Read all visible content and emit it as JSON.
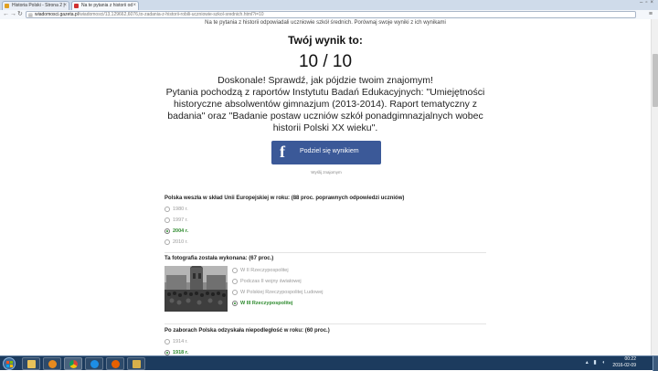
{
  "browser": {
    "tabs": [
      {
        "label": "Historia Polski - Strona 2 |",
        "icon_color": "#e0a020"
      },
      {
        "label": "Na te pytania z historii od",
        "icon_color": "#d03030"
      }
    ],
    "url_domain": "wiadomosci.gazeta.pl",
    "url_path": "/wiadomosci/13,129662,6076,to-zadania-z-historii-robili-uczniowie-szkol-srednich.html?i=10",
    "icons": [
      "back-icon",
      "forward-icon",
      "reload-icon",
      "menu-icon"
    ]
  },
  "page": {
    "top_line": "Na te pytania z historii odpowiadali uczniowie szkół średnich. Porównaj swoje wyniki z ich wynikami",
    "result_title": "Twój wynik to:",
    "score": "10 / 10",
    "description_1": "Doskonale! Sprawdź, jak pójdzie twoim znajomym!",
    "description_2": "Pytania pochodzą z raportów Instytutu Badań Edukacyjnych: \"Umiejętności historyczne absolwentów gimnazjum (2013-2014). Raport tematyczny z badania\" oraz \"Badanie postaw uczniów szkół ponadgimnazjalnych wobec historii Polski XX wieku\".",
    "fb_button_label": "Podziel się wynikiem",
    "fb_logo": "f",
    "fb_sub": "Wyślij znajomym",
    "accent_color": "#3b5998",
    "correct_color": "#2d8a2d"
  },
  "questions": [
    {
      "title": "Polska weszła w skład Unii Europejskiej w roku: (88 proc. poprawnych odpowiedzi uczniów)",
      "options": [
        "1980 r.",
        "1997 r.",
        "2004 r.",
        "2010 r."
      ],
      "correct_index": 2
    },
    {
      "title": "Ta fotografia została wykonana: (67 proc.)",
      "options": [
        "W II Rzeczypospolitej",
        "Podczas II wojny światowej",
        "W Polskiej Rzeczypospolitej Ludowej",
        "W III Rzeczypospolitej"
      ],
      "correct_index": 3
    },
    {
      "title": "Po zaborach Polska odzyskała niepodległość w roku: (60 proc.)",
      "options": [
        "1914 r.",
        "1918 r."
      ],
      "correct_index": 1
    }
  ],
  "taskbar": {
    "time": "00:22",
    "date": "2016-02-09",
    "apps": [
      "windows-explorer-icon",
      "media-player-icon",
      "chrome-icon",
      "internet-explorer-icon",
      "firefox-icon",
      "folder-icon"
    ]
  }
}
